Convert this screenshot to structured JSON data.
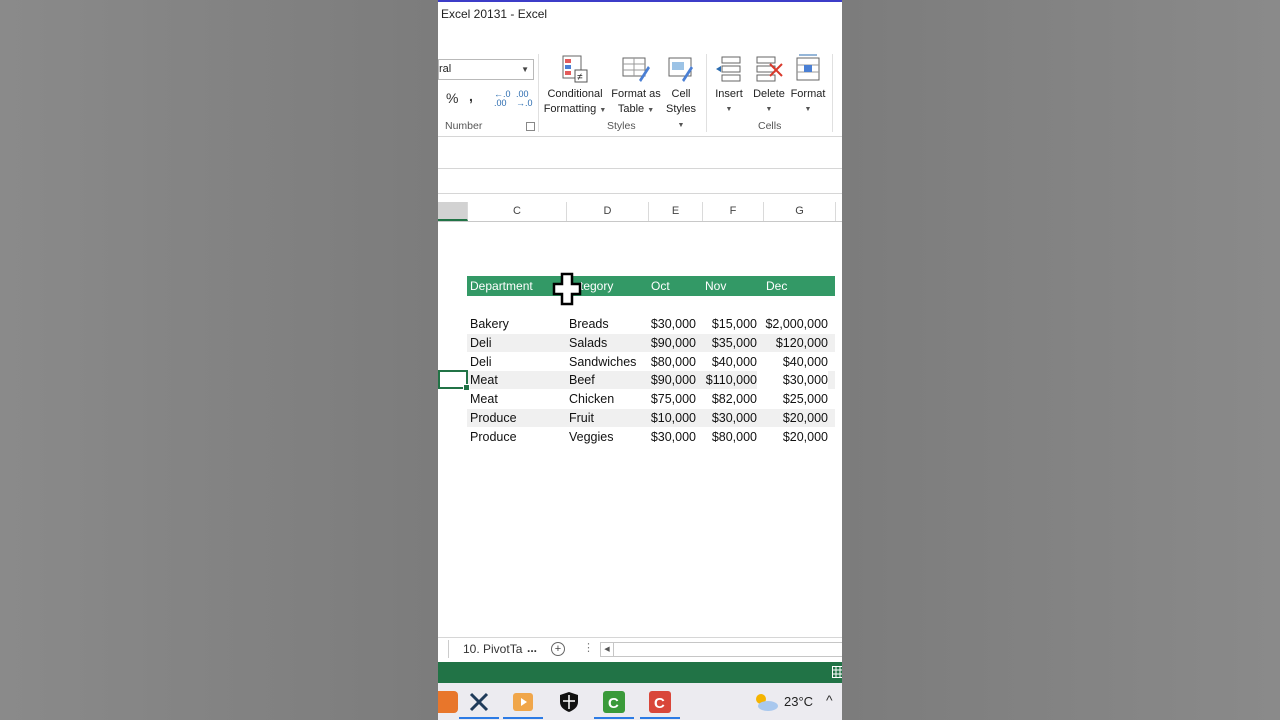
{
  "window": {
    "title": "Excel 20131 - Excel"
  },
  "ribbon": {
    "number_format_value": "ral",
    "percent": "%",
    "comma": ",",
    "increase_decimal": "←.0 .00",
    "decrease_decimal": ".00 →.0",
    "number_group_label": "Number",
    "styles_group_label": "Styles",
    "cells_group_label": "Cells",
    "conditional_formatting": {
      "line1": "Conditional",
      "line2": "Formatting"
    },
    "format_as_table": {
      "line1": "Format as",
      "line2": "Table"
    },
    "cell_styles": {
      "line1": "Cell",
      "line2": "Styles"
    },
    "insert": "Insert",
    "delete": "Delete",
    "format": "Format"
  },
  "columns": [
    "C",
    "D",
    "E",
    "F",
    "G"
  ],
  "table": {
    "headers": [
      "Department",
      "tegory",
      "Oct",
      "Nov",
      "Dec"
    ],
    "rows": [
      [
        "Bakery",
        "Breads",
        "$30,000",
        "$15,000",
        "$2,000,000"
      ],
      [
        "Deli",
        "Salads",
        "$90,000",
        "$35,000",
        "$120,000"
      ],
      [
        "Deli",
        "Sandwiches",
        "$80,000",
        "$40,000",
        "$40,000"
      ],
      [
        "Meat",
        "Beef",
        "$90,000",
        "$110,000",
        "$30,000"
      ],
      [
        "Meat",
        "Chicken",
        "$75,000",
        "$82,000",
        "$25,000"
      ],
      [
        "Produce",
        "Fruit",
        "$10,000",
        "$30,000",
        "$20,000"
      ],
      [
        "Produce",
        "Veggies",
        "$30,000",
        "$80,000",
        "$20,000"
      ]
    ]
  },
  "sheets": {
    "active_tab": "10. PivotTa",
    "more": "..."
  },
  "taskbar": {
    "temperature": "23°C"
  },
  "colors": {
    "excel_green": "#217346",
    "header_green": "#339966"
  }
}
